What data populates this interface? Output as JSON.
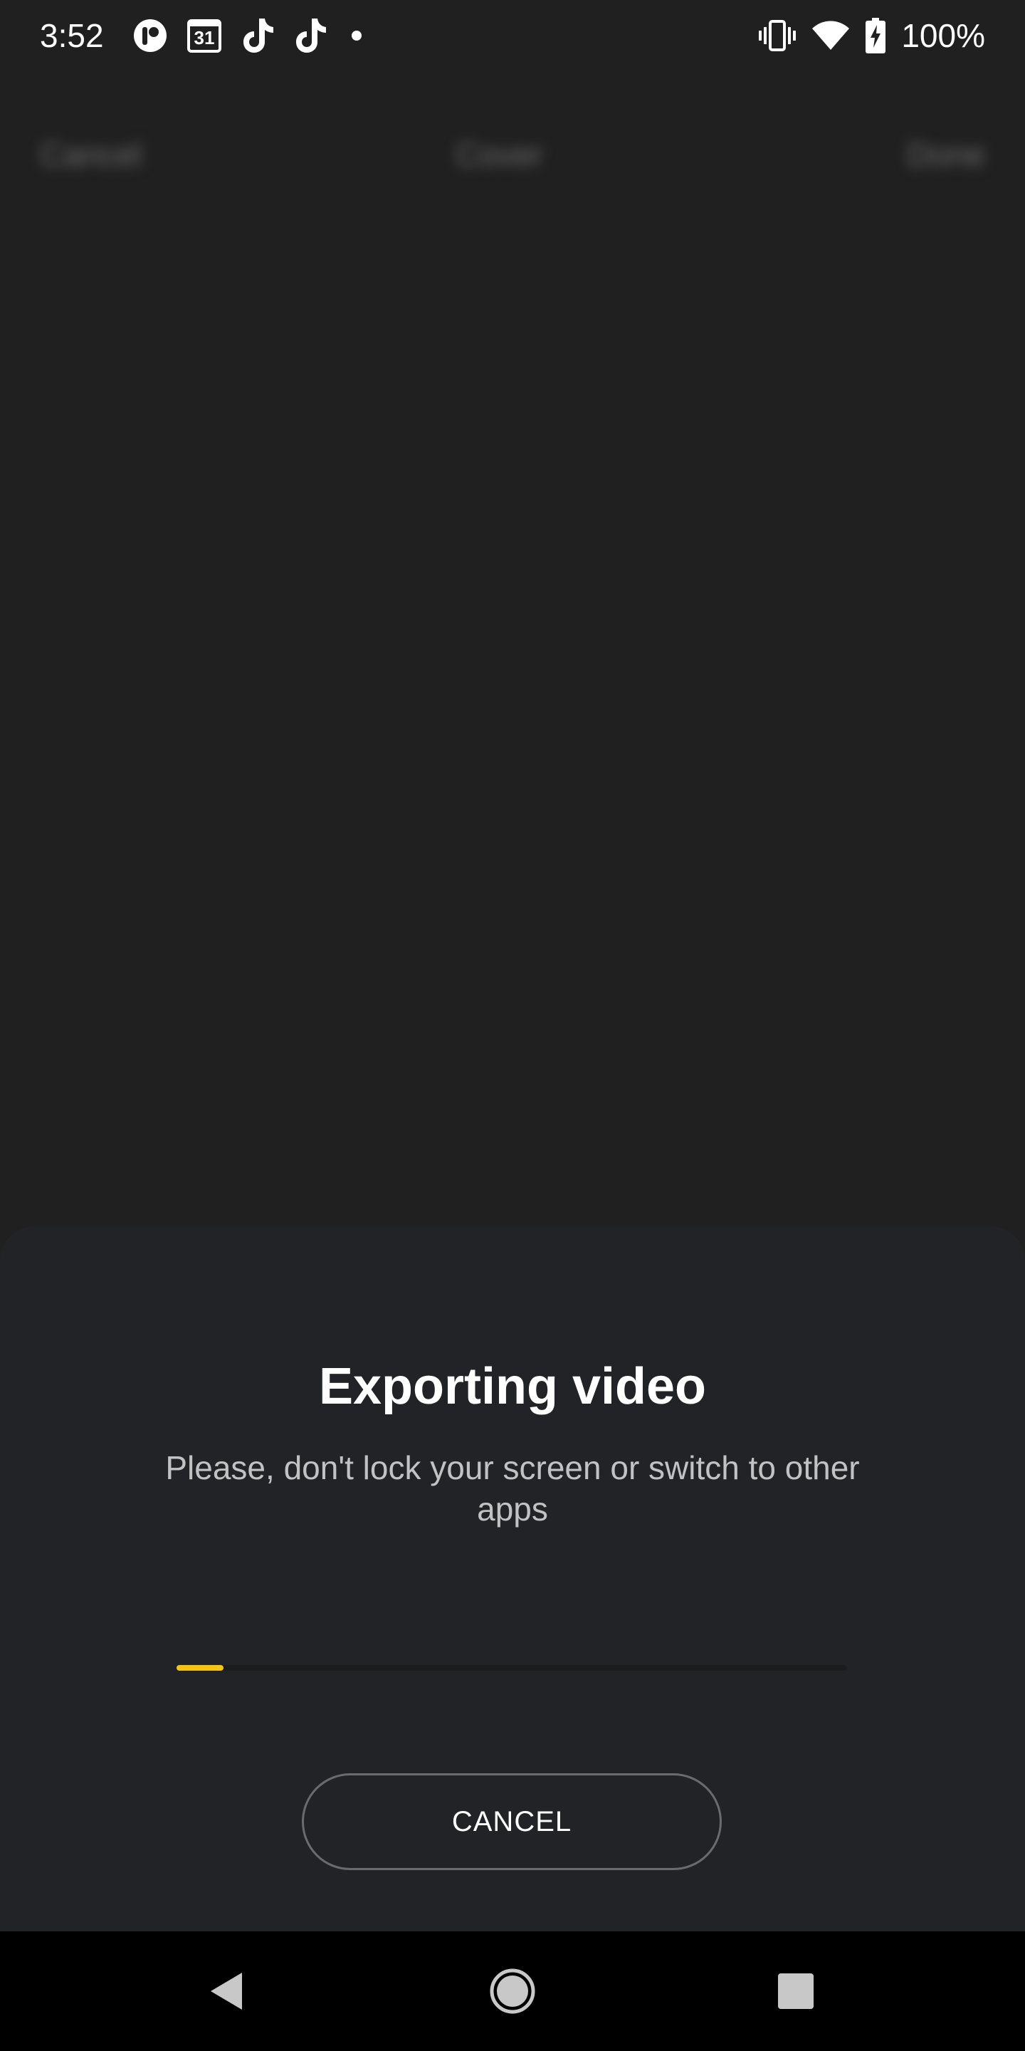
{
  "status_bar": {
    "time": "3:52",
    "calendar_day": "31",
    "battery_text": "100%",
    "left_icons": [
      "app-notification-icon",
      "calendar-icon",
      "tiktok-icon",
      "tiktok-icon",
      "more-notifications-dot-icon"
    ],
    "right_icons": [
      "vibrate-icon",
      "wifi-icon",
      "battery-charging-icon"
    ]
  },
  "background_toolbar": {
    "cancel_label": "Cancel",
    "cover_label": "Cover",
    "done_label": "Done"
  },
  "export_sheet": {
    "title": "Exporting video",
    "subtitle": "Please, don't lock your screen or switch to other apps",
    "progress_fraction": 0.07,
    "progress_color": "#f5c315",
    "cancel_label": "CANCEL"
  },
  "nav_bar": {
    "buttons": [
      "back-icon",
      "home-icon",
      "recents-icon"
    ]
  },
  "colors": {
    "background": "#202020",
    "sheet": "#222326",
    "accent": "#f5c315"
  }
}
